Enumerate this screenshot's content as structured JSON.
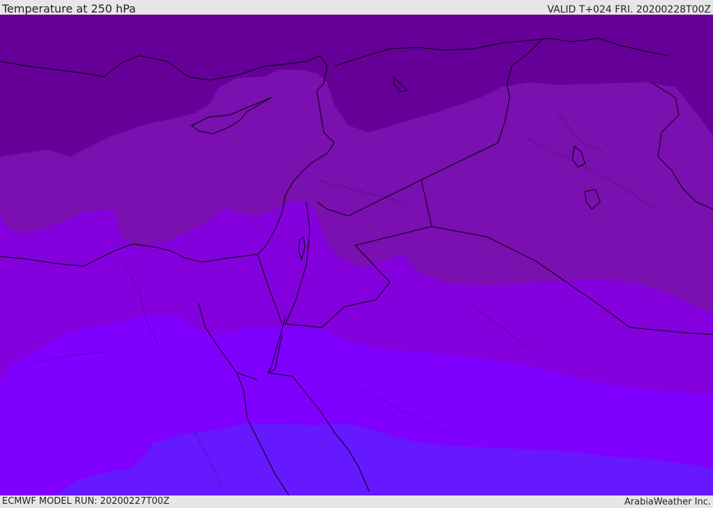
{
  "header": {
    "title": "Temperature at 250 hPa",
    "valid": "VALID T+024 FRI. 20200228T00Z"
  },
  "footer": {
    "model_run": "ECMWF MODEL RUN: 20200227T00Z",
    "credit": "ArabiaWeather Inc."
  },
  "palette": {
    "band_coldest": "#660099",
    "band_2": "#7a10b0",
    "band_3": "#8400dd",
    "band_4": "#8000ff",
    "band_warmest": "#6618ff",
    "coastline": "#000000"
  }
}
